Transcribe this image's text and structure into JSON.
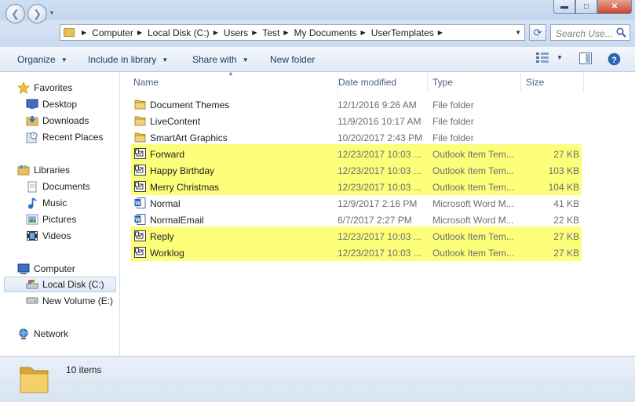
{
  "window": {
    "minimize_icon": "minimize-icon",
    "maximize_icon": "maximize-icon",
    "close_icon": "close-icon"
  },
  "address": {
    "crumbs": [
      "Computer",
      "Local Disk (C:)",
      "Users",
      "Test",
      "My Documents",
      "UserTemplates"
    ]
  },
  "search": {
    "placeholder": "Search Use..."
  },
  "toolbar": {
    "organize": "Organize",
    "include_in_library": "Include in library",
    "share_with": "Share with",
    "new_folder": "New folder"
  },
  "nav": {
    "favorites": "Favorites",
    "desktop": "Desktop",
    "downloads": "Downloads",
    "recent_places": "Recent Places",
    "libraries": "Libraries",
    "documents": "Documents",
    "music": "Music",
    "pictures": "Pictures",
    "videos": "Videos",
    "computer": "Computer",
    "local_disk": "Local Disk (C:)",
    "new_volume": "New Volume (E:)",
    "network": "Network"
  },
  "columns": {
    "name": "Name",
    "date_modified": "Date modified",
    "type": "Type",
    "size": "Size"
  },
  "files": [
    {
      "name": "Document Themes",
      "date": "12/1/2016 9:26 AM",
      "type": "File folder",
      "size": "",
      "icon": "folder-icon",
      "highlight": false
    },
    {
      "name": "LiveContent",
      "date": "11/9/2016 10:17 AM",
      "type": "File folder",
      "size": "",
      "icon": "folder-icon",
      "highlight": false
    },
    {
      "name": "SmartArt Graphics",
      "date": "10/20/2017 2:43 PM",
      "type": "File folder",
      "size": "",
      "icon": "folder-icon",
      "highlight": false
    },
    {
      "name": "Forward",
      "date": "12/23/2017 10:03 ...",
      "type": "Outlook Item Tem...",
      "size": "27 KB",
      "icon": "outlook-template-icon",
      "highlight": true
    },
    {
      "name": "Happy Birthday",
      "date": "12/23/2017 10:03 ...",
      "type": "Outlook Item Tem...",
      "size": "103 KB",
      "icon": "outlook-template-icon",
      "highlight": true
    },
    {
      "name": "Merry Christmas",
      "date": "12/23/2017 10:03 ...",
      "type": "Outlook Item Tem...",
      "size": "104 KB",
      "icon": "outlook-template-icon",
      "highlight": true
    },
    {
      "name": "Normal",
      "date": "12/9/2017 2:16 PM",
      "type": "Microsoft Word M...",
      "size": "41 KB",
      "icon": "word-document-icon",
      "highlight": false
    },
    {
      "name": "NormalEmail",
      "date": "6/7/2017 2:27 PM",
      "type": "Microsoft Word M...",
      "size": "22 KB",
      "icon": "word-document-icon",
      "highlight": false
    },
    {
      "name": "Reply",
      "date": "12/23/2017 10:03 ...",
      "type": "Outlook Item Tem...",
      "size": "27 KB",
      "icon": "outlook-template-icon",
      "highlight": true
    },
    {
      "name": "Worklog",
      "date": "12/23/2017 10:03 ...",
      "type": "Outlook Item Tem...",
      "size": "27 KB",
      "icon": "outlook-template-icon",
      "highlight": true
    }
  ],
  "status": {
    "item_count": "10 items"
  },
  "colors": {
    "highlight": "#fdfe7a",
    "folder": "#e7c05c",
    "accent": "#1e395b"
  }
}
